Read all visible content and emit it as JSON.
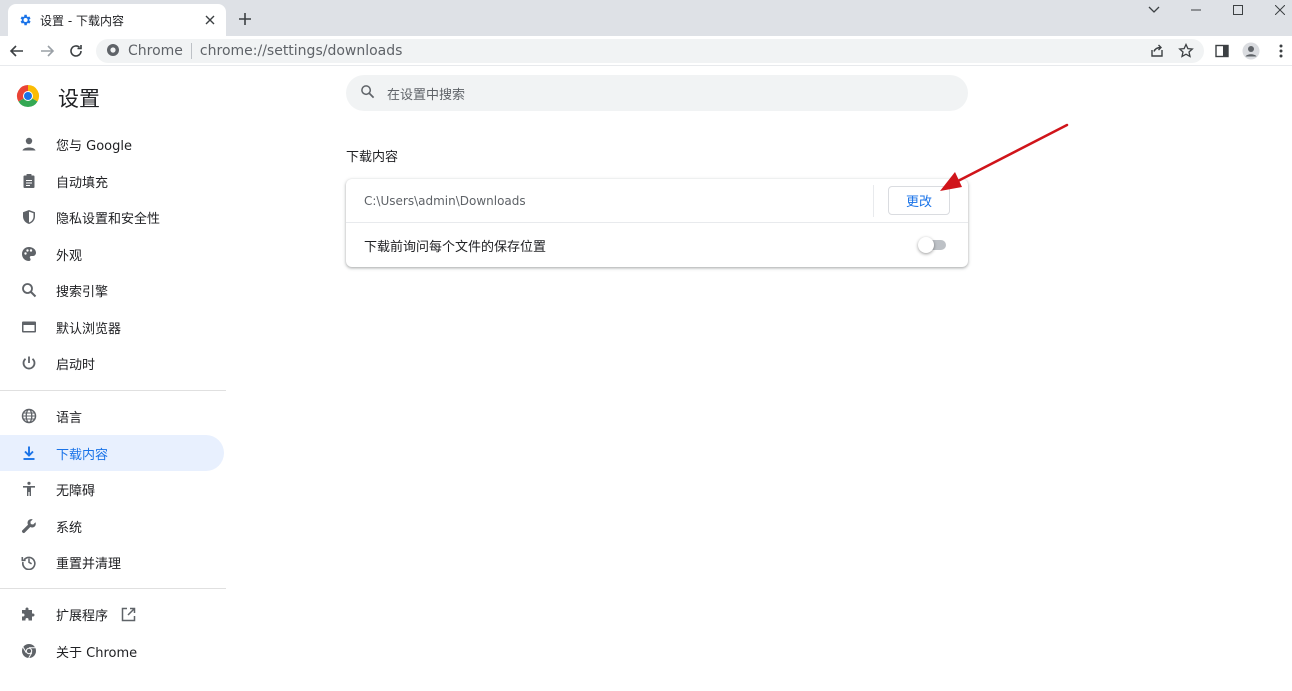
{
  "browser": {
    "tab_title": "设置 - 下载内容",
    "omnibox_chip": "Chrome",
    "omnibox_url": "chrome://settings/downloads"
  },
  "sidebar": {
    "title": "设置",
    "items": [
      {
        "label": "您与 Google",
        "icon": "person-icon"
      },
      {
        "label": "自动填充",
        "icon": "clipboard-icon"
      },
      {
        "label": "隐私设置和安全性",
        "icon": "shield-icon"
      },
      {
        "label": "外观",
        "icon": "palette-icon"
      },
      {
        "label": "搜索引擎",
        "icon": "search-icon"
      },
      {
        "label": "默认浏览器",
        "icon": "browser-icon"
      },
      {
        "label": "启动时",
        "icon": "power-icon"
      },
      {
        "label": "语言",
        "icon": "globe-icon"
      },
      {
        "label": "下载内容",
        "icon": "download-icon",
        "active": true
      },
      {
        "label": "无障碍",
        "icon": "accessibility-icon"
      },
      {
        "label": "系统",
        "icon": "wrench-icon"
      },
      {
        "label": "重置并清理",
        "icon": "history-icon"
      },
      {
        "label": "扩展程序",
        "icon": "puzzle-icon"
      },
      {
        "label": "关于 Chrome",
        "icon": "chrome-icon"
      }
    ]
  },
  "search": {
    "placeholder": "在设置中搜索"
  },
  "downloads": {
    "section_title": "下载内容",
    "location_path": "C:\\Users\\admin\\Downloads",
    "change_label": "更改",
    "ask_label": "下载前询问每个文件的保存位置",
    "ask_enabled": false
  },
  "colors": {
    "accent": "#1a73e8",
    "active_bg": "#e8f0fe",
    "annotation_arrow": "#d0141a"
  }
}
